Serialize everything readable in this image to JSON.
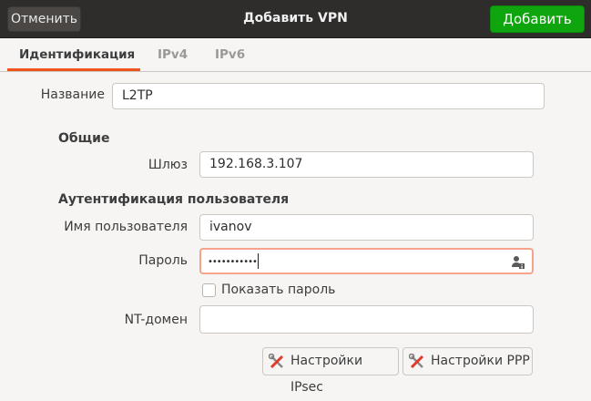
{
  "header": {
    "cancel_label": "Отменить",
    "title": "Добавить VPN",
    "add_label": "Добавить"
  },
  "tabs": [
    {
      "label": "Идентификация"
    },
    {
      "label": "IPv4"
    },
    {
      "label": "IPv6"
    }
  ],
  "form": {
    "name_label": "Название",
    "name_value": "L2TP",
    "general_heading": "Общие",
    "gateway_label": "Шлюз",
    "gateway_value": "192.168.3.107",
    "auth_heading": "Аутентификация пользователя",
    "username_label": "Имя пользователя",
    "username_value": "ivanov",
    "password_label": "Пароль",
    "password_value": "•••••••••••",
    "show_password_label": "Показать пароль",
    "show_password_checked": false,
    "ntdomain_label": "NT-домен",
    "ntdomain_value": ""
  },
  "buttons": {
    "ipsec_label": "Настройки IPsec",
    "ppp_label": "Настройки PPP"
  },
  "colors": {
    "accent": "#f0541e",
    "add_button": "#0ea50e",
    "header": "#2f2d2b"
  }
}
